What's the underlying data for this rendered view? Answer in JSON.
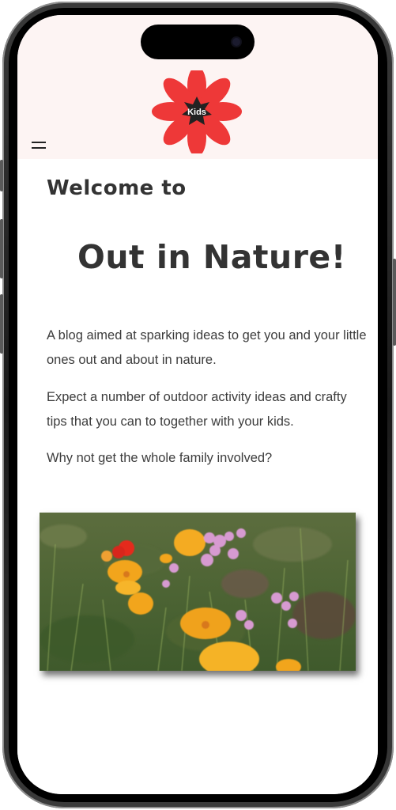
{
  "header": {
    "logo_text": "Kids",
    "menu_icon": "hamburger-menu-icon"
  },
  "main": {
    "welcome": "Welcome to",
    "title": "Out in Nature!",
    "paragraphs": [
      "A blog aimed at sparking ideas to get you and your little ones out and about in nature.",
      "Expect a number of outdoor activity ideas and crafty tips that you can to together with your kids.",
      "Why not get the whole family involved?"
    ],
    "image_icon": "wildflowers-photo"
  },
  "colors": {
    "header_bg": "#fdf4f3",
    "logo_petals": "#ee3838",
    "logo_center": "#222222",
    "text": "#333333"
  }
}
